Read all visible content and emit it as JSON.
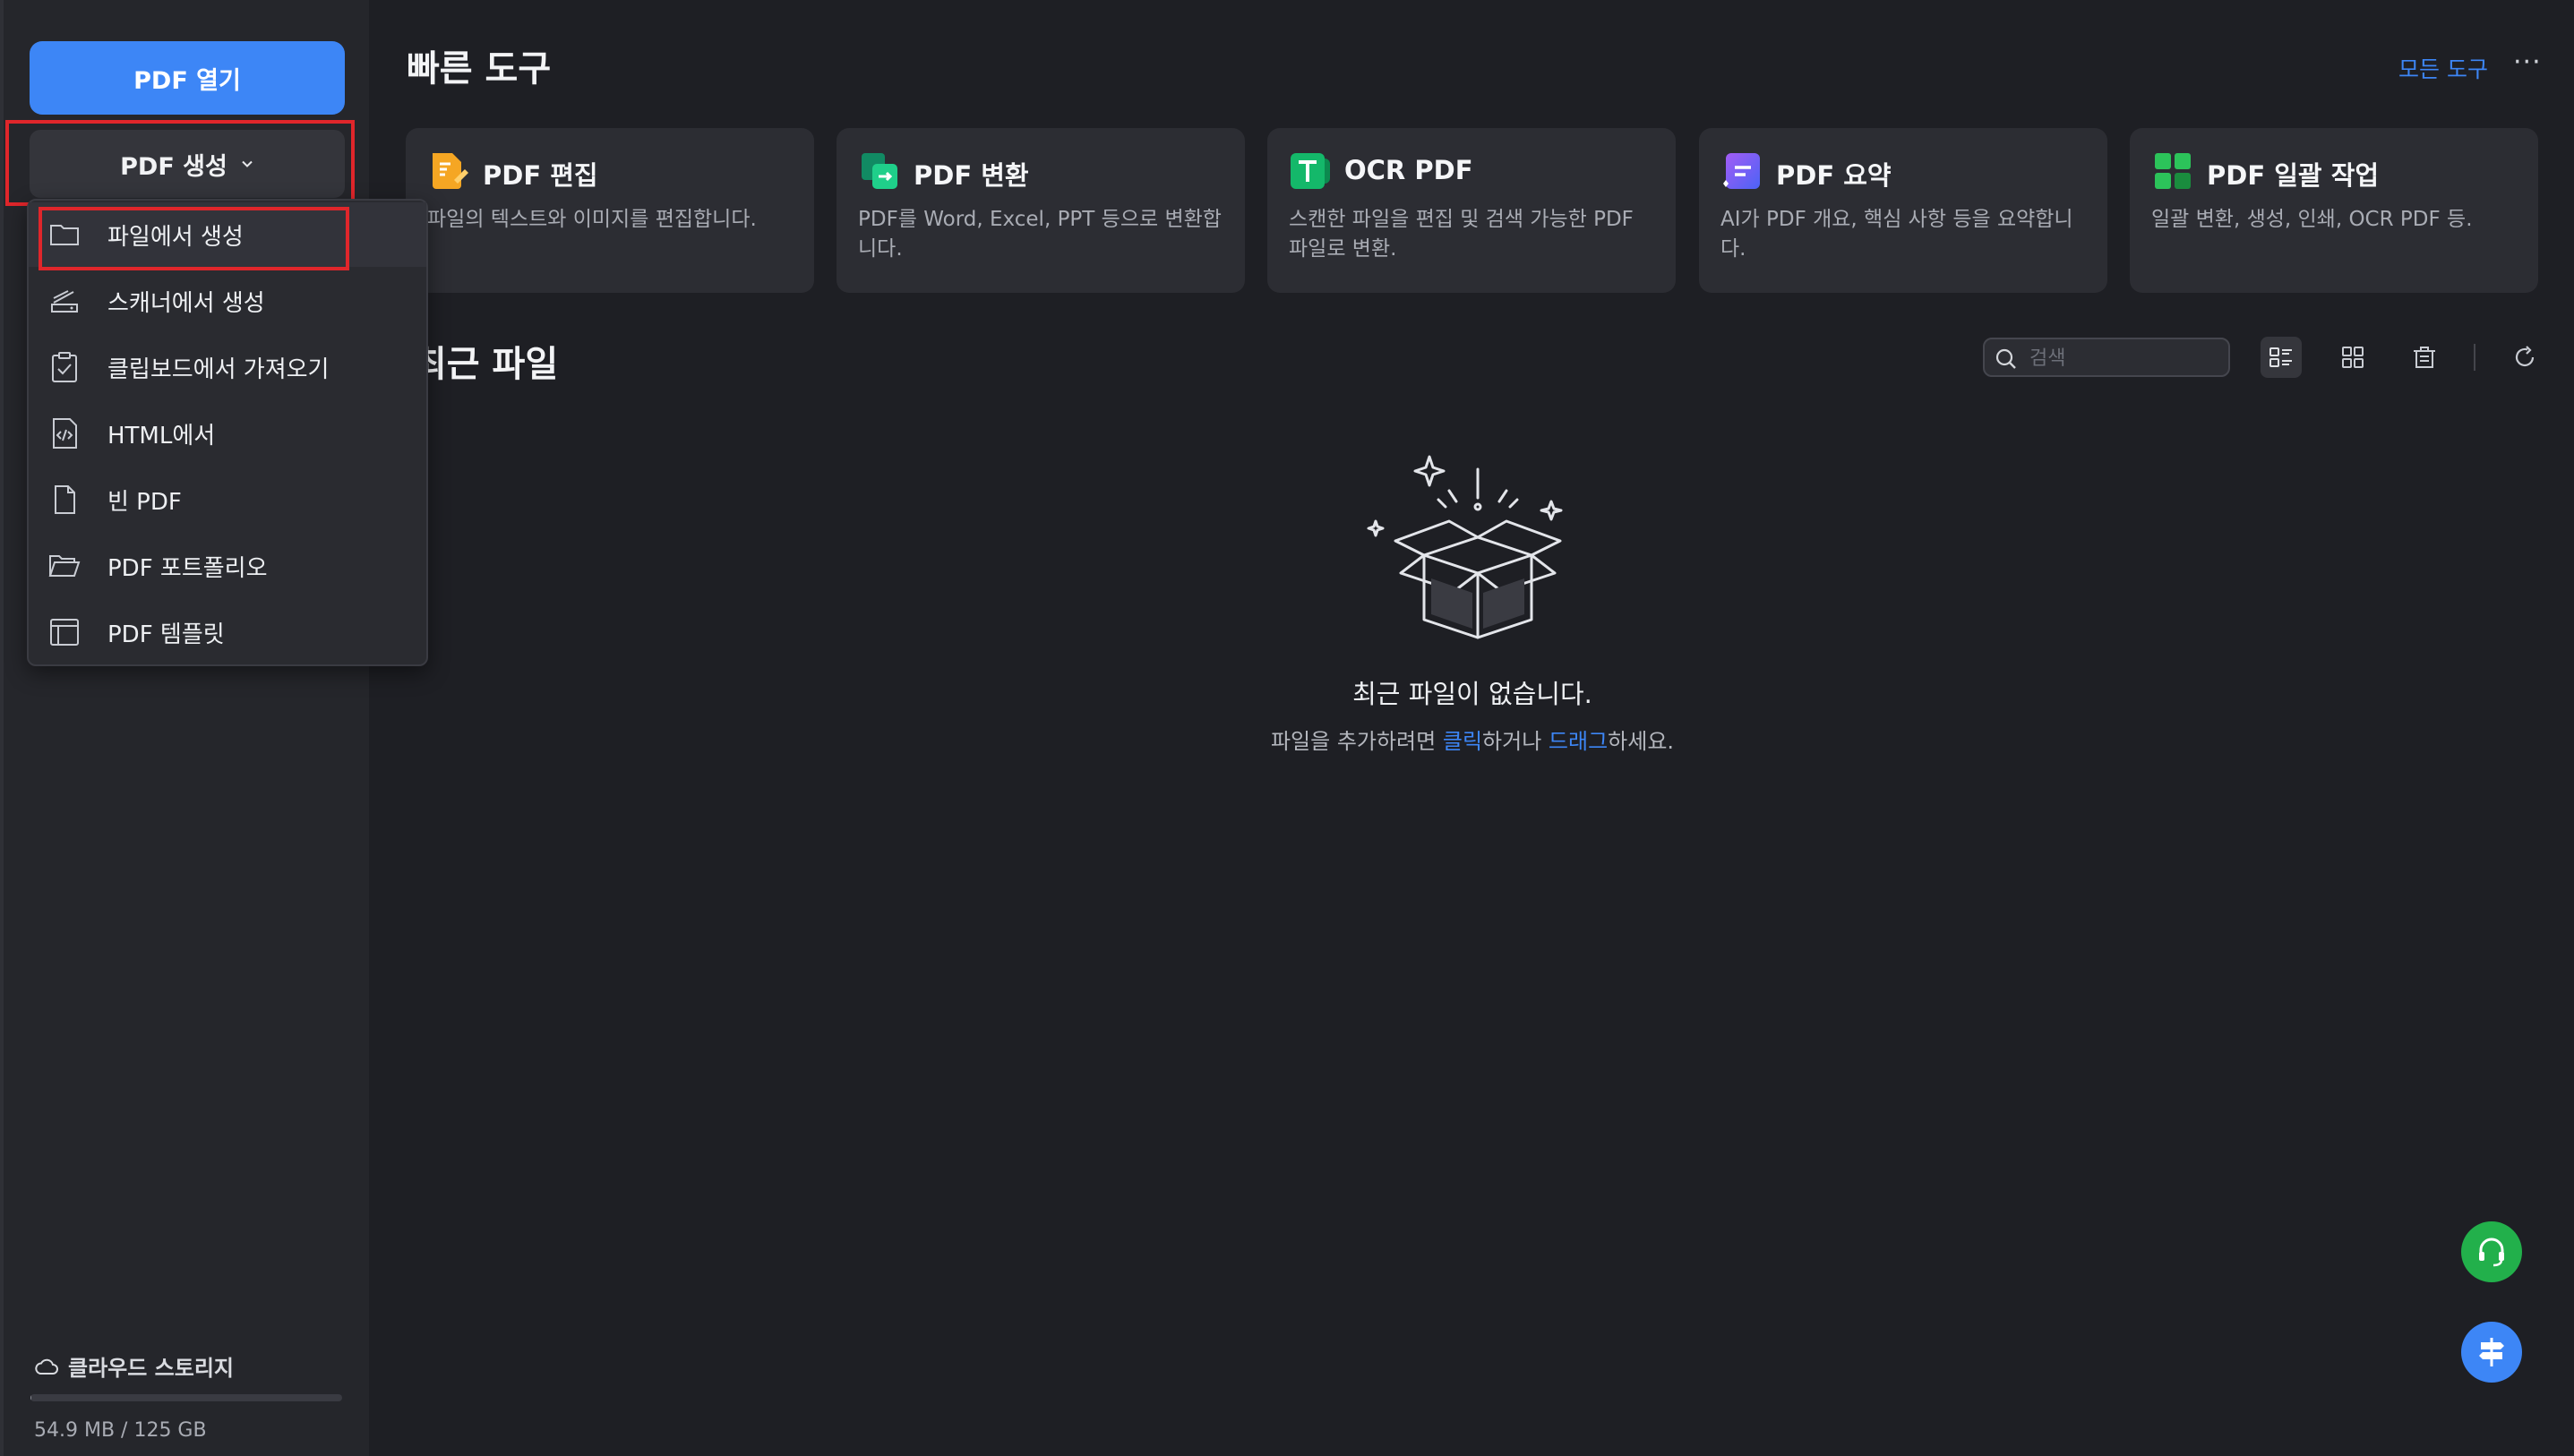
{
  "sidebar": {
    "open_pdf_label": "PDF 열기",
    "create_pdf_label": "PDF 생성",
    "cloud_label": "클라우드 스토리지",
    "storage_used_fraction": 0.0004,
    "storage_text": "54.9 MB / 125 GB"
  },
  "dropdown": {
    "items": [
      {
        "label": "파일에서 생성",
        "icon": "folder-icon"
      },
      {
        "label": "스캐너에서 생성",
        "icon": "scanner-icon"
      },
      {
        "label": "클립보드에서 가져오기",
        "icon": "clipboard-icon"
      },
      {
        "label": "HTML에서",
        "icon": "html-code-icon"
      },
      {
        "label": "빈 PDF",
        "icon": "blank-page-icon"
      },
      {
        "label": "PDF 포트폴리오",
        "icon": "open-folder-icon"
      },
      {
        "label": "PDF 템플릿",
        "icon": "template-icon"
      }
    ]
  },
  "quick_tools": {
    "title": "빠른 도구",
    "all_tools_label": "모든 도구",
    "more_label": "···",
    "cards": [
      {
        "title": "PDF 편집",
        "desc": "파일의 텍스트와 이미지를 편집합니다.",
        "color": "#f5a623"
      },
      {
        "title": "PDF 변환",
        "desc": "PDF를 Word, Excel, PPT 등으로 변환합니다.",
        "color": "#1fb57a"
      },
      {
        "title": "OCR PDF",
        "desc": "스캔한 파일을 편집 및 검색 가능한 PDF 파일로 변환.",
        "color": "#14b86a"
      },
      {
        "title": "PDF 요약",
        "desc": "AI가 PDF 개요, 핵심 사항 등을 요약합니다.",
        "color": "#7b5cf5"
      },
      {
        "title": "PDF 일괄 작업",
        "desc": "일괄 변환, 생성, 인쇄, OCR PDF 등.",
        "color": "#2cc35a"
      }
    ]
  },
  "recent": {
    "title": "최근 파일",
    "search_placeholder": "검색",
    "empty_title": "최근 파일이 없습니다.",
    "empty_sub_prefix": "파일을 추가하려면 ",
    "empty_sub_link1": "클릭",
    "empty_sub_mid": "하거나 ",
    "empty_sub_link2": "드래그",
    "empty_sub_suffix": "하세요."
  },
  "colors": {
    "accent": "#3d86f6",
    "highlight": "#e0262b",
    "support_fab": "#22b04b",
    "feedback_fab": "#3d86f6"
  }
}
